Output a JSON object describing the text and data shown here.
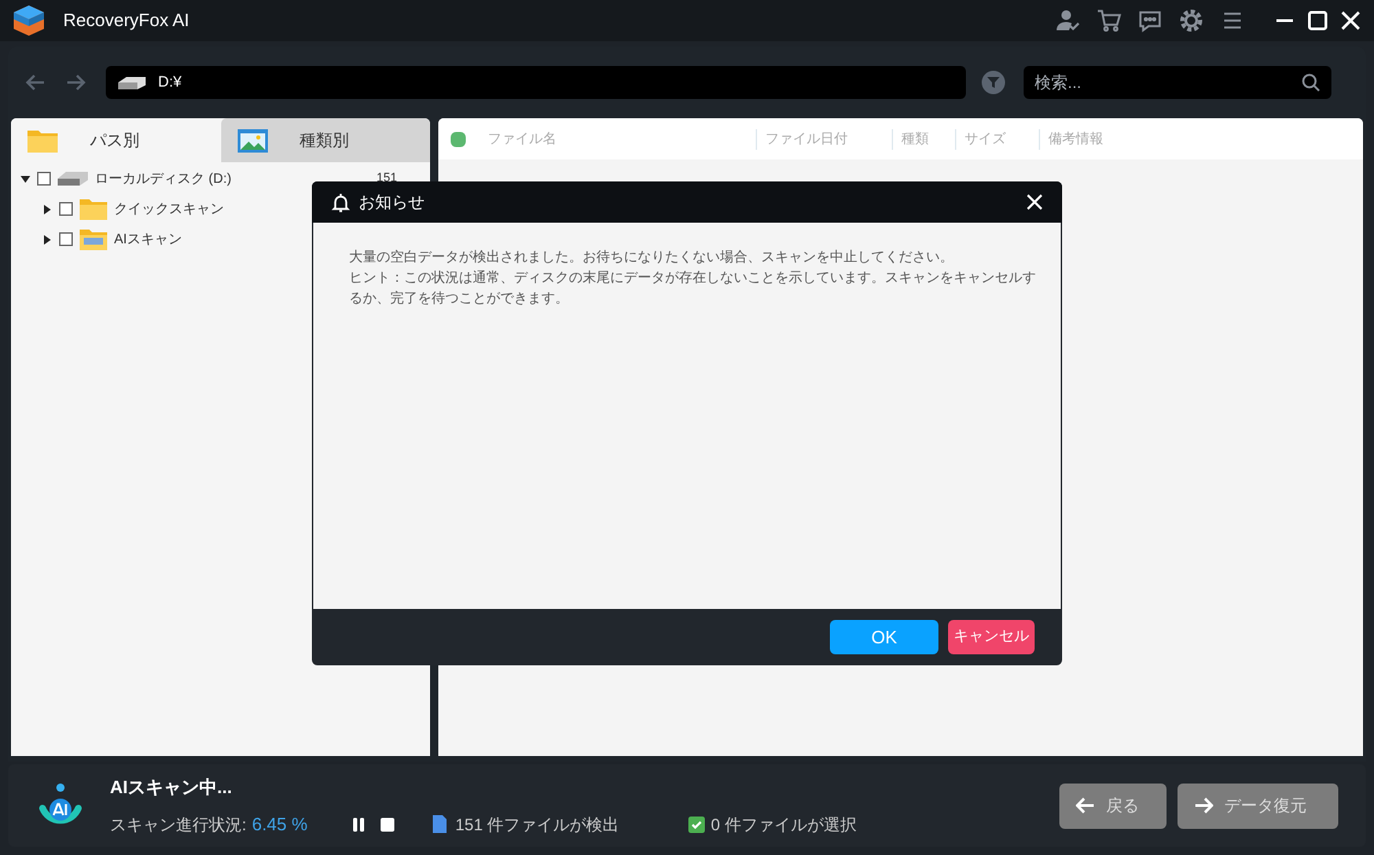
{
  "window": {
    "title": "RecoveryFox AI"
  },
  "toolbar": {
    "path": "D:¥",
    "search_placeholder": "検索..."
  },
  "left_tabs": [
    {
      "label": "パス別",
      "selected": true,
      "kind": "folder"
    },
    {
      "label": "種類別",
      "selected": false,
      "kind": "image"
    }
  ],
  "tree": [
    {
      "label": "ローカルディスク (D:)",
      "kind": "disk",
      "count": "151",
      "checked": false,
      "expanded": true,
      "children": [
        {
          "label": "クイックスキャン",
          "kind": "folder",
          "checked": false,
          "expanded": false
        },
        {
          "label": "AIスキャン",
          "kind": "ai-folder",
          "checked": false,
          "expanded": false
        }
      ]
    }
  ],
  "table": {
    "select_all_checked": false,
    "columns": [
      "ファイル名",
      "ファイル日付",
      "種類",
      "サイズ",
      "備考情報"
    ]
  },
  "dialog": {
    "title": "お知らせ",
    "lines": [
      "大量の空白データが検出されました。お待ちになりたくない場合、スキャンを中止してください。",
      "ヒント：この状況は通常、ディスクの末尾にデータが存在しないことを示しています。スキャンをキャンセルするか、完了を待つことができます。"
    ],
    "buttons": [
      {
        "label": "OK",
        "kind": "primary"
      },
      {
        "label": "キャンセル",
        "kind": "danger"
      }
    ]
  },
  "status": {
    "title": "AIスキャン中...",
    "progress_label": "スキャン進行状況:",
    "progress_value": "6.45 %",
    "found": "151 件ファイルが検出",
    "selected": "0 件ファイルが選択"
  },
  "nav_buttons": [
    {
      "label": "戻る",
      "kind": "back"
    },
    {
      "label": "データ復元",
      "kind": "forward"
    }
  ]
}
